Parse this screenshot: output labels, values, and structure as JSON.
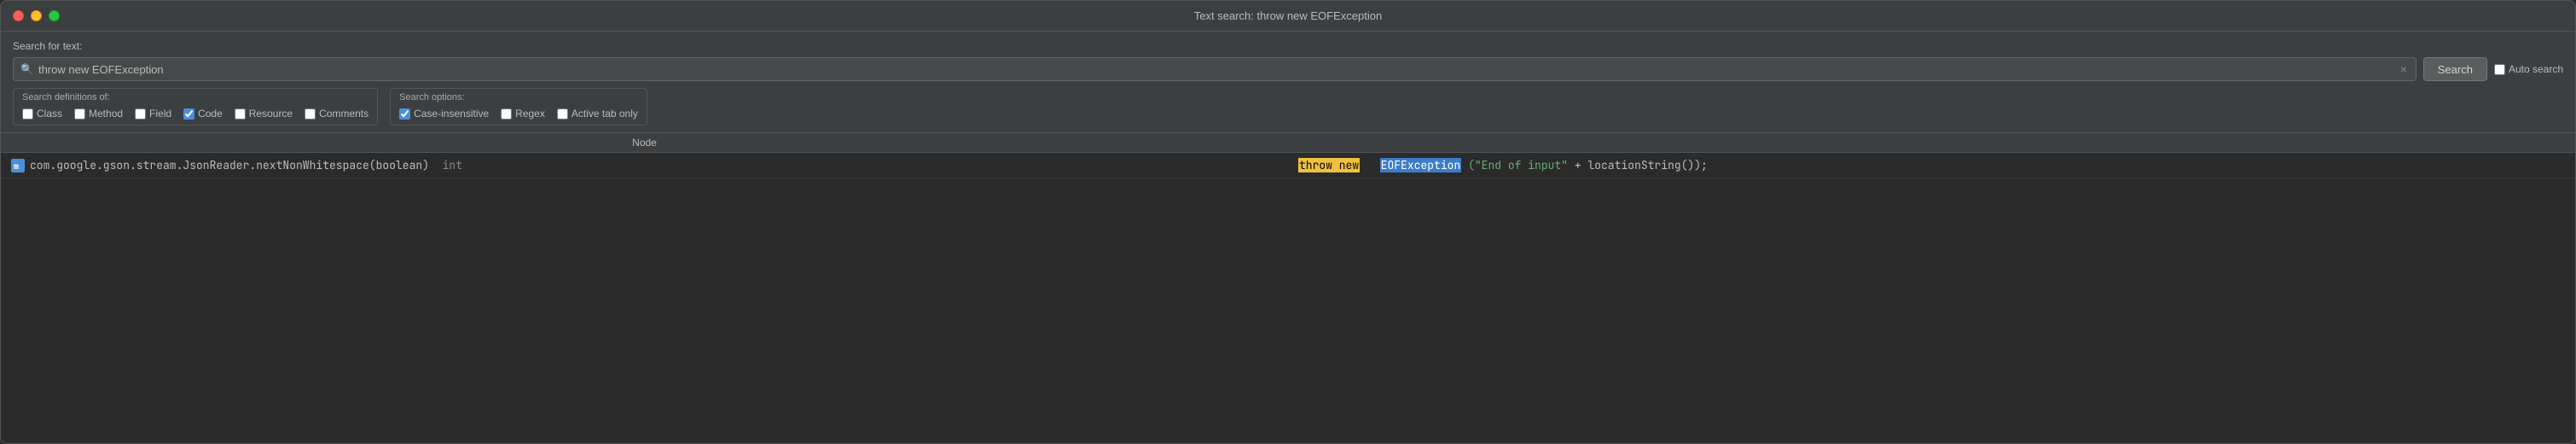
{
  "window": {
    "title": "Text search: throw new EOFException"
  },
  "traffic_lights": {
    "close_label": "close",
    "minimize_label": "minimize",
    "maximize_label": "maximize"
  },
  "search_panel": {
    "search_for_text_label": "Search for text:",
    "search_input_value": "throw new EOFException",
    "search_input_placeholder": "",
    "clear_button_label": "×",
    "search_button_label": "Search",
    "auto_search_label": "Auto search"
  },
  "definitions_group": {
    "label": "Search definitions of:",
    "checkboxes": [
      {
        "id": "cb-class",
        "label": "Class",
        "checked": false
      },
      {
        "id": "cb-method",
        "label": "Method",
        "checked": false
      },
      {
        "id": "cb-field",
        "label": "Field",
        "checked": false
      },
      {
        "id": "cb-code",
        "label": "Code",
        "checked": true
      },
      {
        "id": "cb-resource",
        "label": "Resource",
        "checked": false
      },
      {
        "id": "cb-comments",
        "label": "Comments",
        "checked": false
      }
    ]
  },
  "options_group": {
    "label": "Search options:",
    "checkboxes": [
      {
        "id": "cb-case",
        "label": "Case-insensitive",
        "checked": true
      },
      {
        "id": "cb-regex",
        "label": "Regex",
        "checked": false
      },
      {
        "id": "cb-active",
        "label": "Active tab only",
        "checked": false
      }
    ]
  },
  "results_table": {
    "columns": [
      "Node",
      ""
    ],
    "rows": [
      {
        "node_icon": "java-method",
        "node_text": "com.google.gson.stream.JsonReader.nextNonWhitespace(boolean)",
        "node_return_type": "int",
        "code_prefix": "",
        "highlight1": "throw new",
        "highlight2": "EOFException",
        "code_suffix": "(\"End of input\" + locationString());"
      }
    ]
  }
}
